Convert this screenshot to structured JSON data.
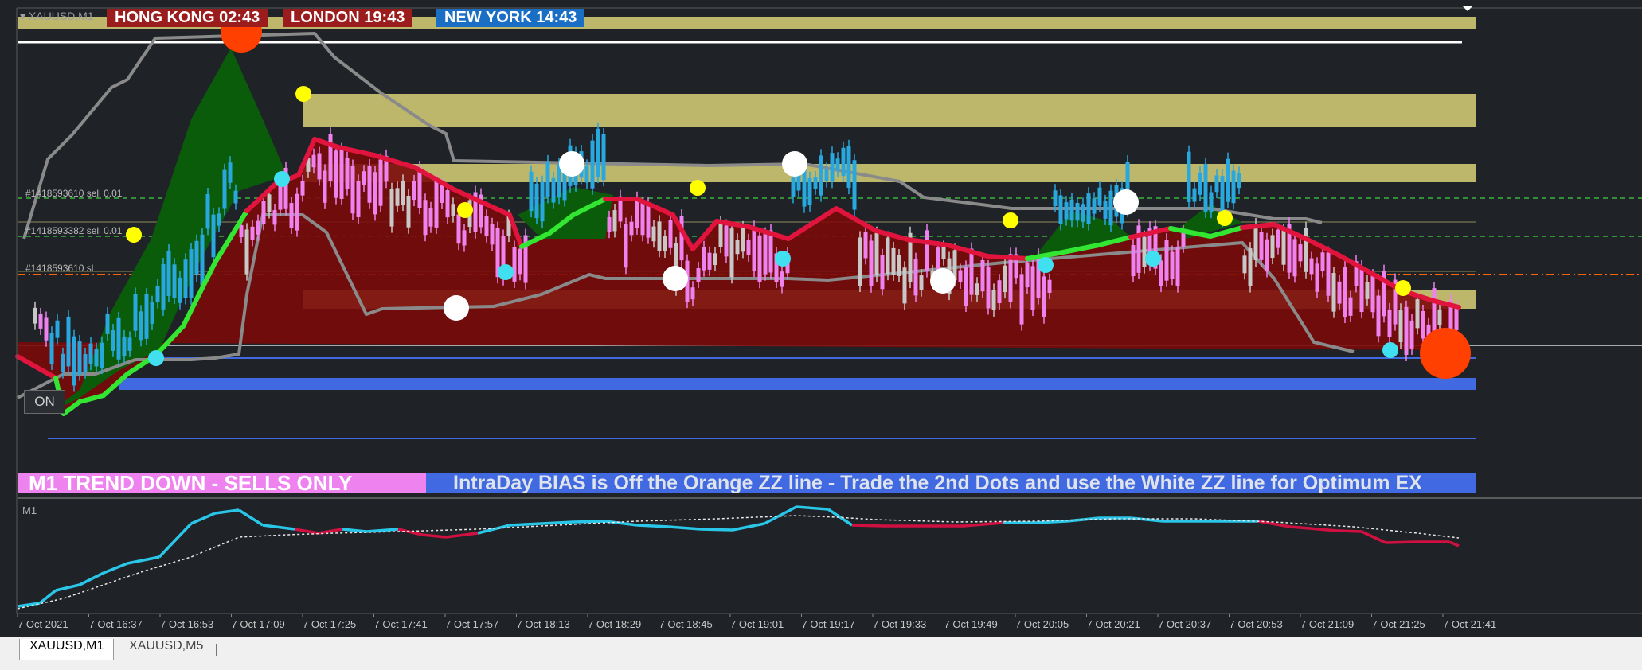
{
  "chart": {
    "symbol": "XAUUSD,M1",
    "timeframe_label": "M1",
    "sessions": [
      {
        "label": "HONG KONG 02:43"
      },
      {
        "label": "LONDON 19:43"
      },
      {
        "label": "NEW YORK 14:43"
      }
    ],
    "order_lines": [
      {
        "label": "#1418593610 sell 0.01"
      },
      {
        "label": "#1418593382 sell 0.01"
      },
      {
        "label": "#1418593610 sl"
      }
    ],
    "on_button": "ON",
    "trend_banner": "M1  TREND DOWN - SELLS ONLY",
    "bias_banner": "IntraDay BIAS is Off the Orange ZZ line - Trade the 2nd Dots and use the White ZZ line for Optimum EX",
    "time_ticks": [
      "7 Oct 2021",
      "7 Oct 16:37",
      "7 Oct 16:53",
      "7 Oct 17:09",
      "7 Oct 17:25",
      "7 Oct 17:41",
      "7 Oct 17:57",
      "7 Oct 18:13",
      "7 Oct 18:29",
      "7 Oct 18:45",
      "7 Oct 19:01",
      "7 Oct 19:17",
      "7 Oct 19:33",
      "7 Oct 19:49",
      "7 Oct 20:05",
      "7 Oct 20:21",
      "7 Oct 20:37",
      "7 Oct 20:53",
      "7 Oct 21:09",
      "7 Oct 21:25",
      "7 Oct 21:41"
    ]
  },
  "tabs": [
    {
      "label": "XAUUSD,M1",
      "active": true
    },
    {
      "label": "XAUUSD,M5",
      "active": false
    }
  ],
  "colors": {
    "background": "#1f2226",
    "bull_candle": "#29a8e0",
    "bear_candle": "#ee82ee",
    "neutral_candle": "#c8c8c8",
    "supply_zone": "#bdb76b",
    "demand_zone": "#4169e1",
    "uptrend_fill": "#0a5c0a",
    "downtrend_fill": "#7a0a0a",
    "uptrend_line": "#32e632",
    "downtrend_line": "#e0143c",
    "channel": "#8a8a8a",
    "sell_line": "#3cb43c",
    "sl_line": "#ff6400",
    "osc_up": "#29c6e8",
    "osc_down": "#d01040"
  }
}
